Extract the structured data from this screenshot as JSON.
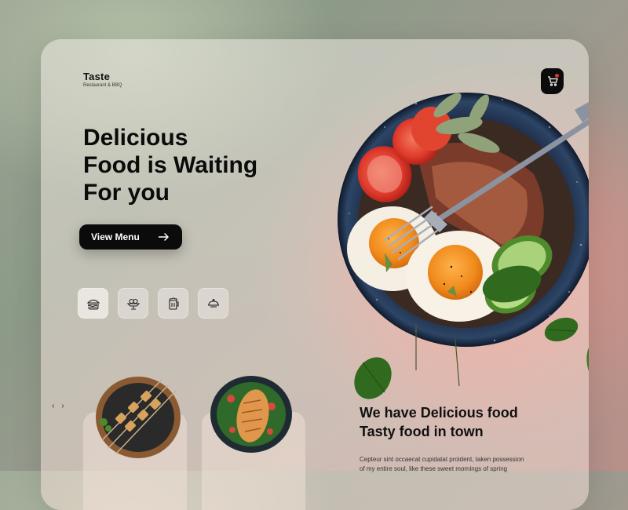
{
  "brand": {
    "name": "Taste",
    "tagline": "Restaurant & BBQ"
  },
  "hero": {
    "title_lines": [
      "Delicious",
      "Food is Waiting",
      "For you"
    ],
    "cta_label": "View Menu"
  },
  "categories": [
    {
      "icon": "burger-icon"
    },
    {
      "icon": "dessert-icon"
    },
    {
      "icon": "beer-icon"
    },
    {
      "icon": "dish-icon"
    }
  ],
  "cart": {
    "icon": "cart-icon"
  },
  "carousel": {
    "prev_label": "‹",
    "next_label": "›"
  },
  "about": {
    "title_lines": [
      "We have Delicious food",
      "Tasty food in town"
    ],
    "text": "Cepteur sint occaecat cupidatat proident, taken possession of my entire soul, like these sweet mornings of spring"
  },
  "colors": {
    "accent": "#e4332f",
    "dark": "#0b0b0b",
    "background": "#9aa394"
  }
}
